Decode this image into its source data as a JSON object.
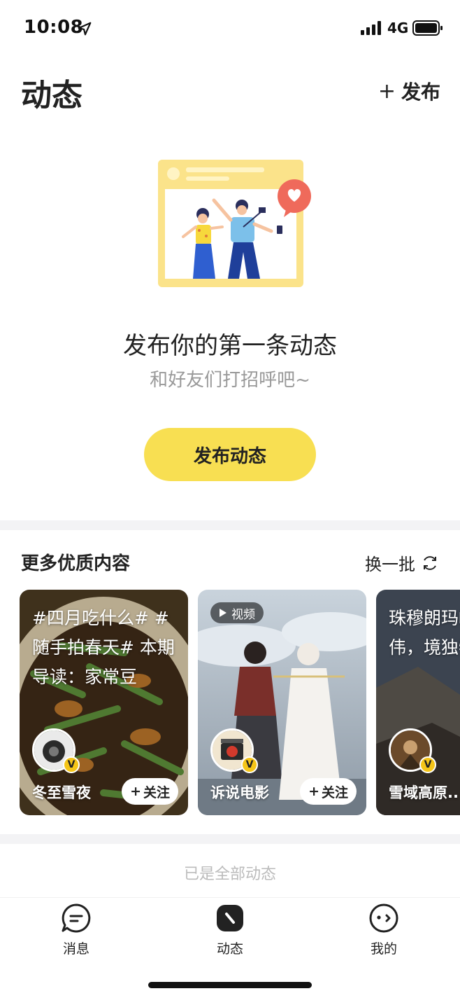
{
  "status_bar": {
    "time": "10:08",
    "network": "4G"
  },
  "header": {
    "title": "动态",
    "publish_label": "发布",
    "publish_plus": "+"
  },
  "empty_state": {
    "title": "发布你的第一条动态",
    "subtitle": "和好友们打招呼吧~",
    "button_label": "发布动态"
  },
  "recommend": {
    "title": "更多优质内容",
    "refresh_label": "换一批",
    "cards": [
      {
        "text": "#四月吃什么# #随手拍春天# 本期导读：家常豆",
        "username": "冬至雪夜",
        "follow_label": "关注",
        "follow_plus": "+",
        "verified": "V"
      },
      {
        "badge": "视频",
        "username": "诉说电影",
        "follow_label": "关注",
        "follow_plus": "+",
        "verified": "V"
      },
      {
        "text": "珠穆朗玛峰高势伟，境独特，",
        "username": "雪域高原..",
        "verified": "V"
      }
    ]
  },
  "footer_note": "已是全部动态",
  "tabs": [
    {
      "label": "消息",
      "icon": "message-icon"
    },
    {
      "label": "动态",
      "icon": "moments-icon"
    },
    {
      "label": "我的",
      "icon": "profile-icon"
    }
  ],
  "colors": {
    "accent": "#f8df52",
    "divider": "#f3f3f5"
  }
}
